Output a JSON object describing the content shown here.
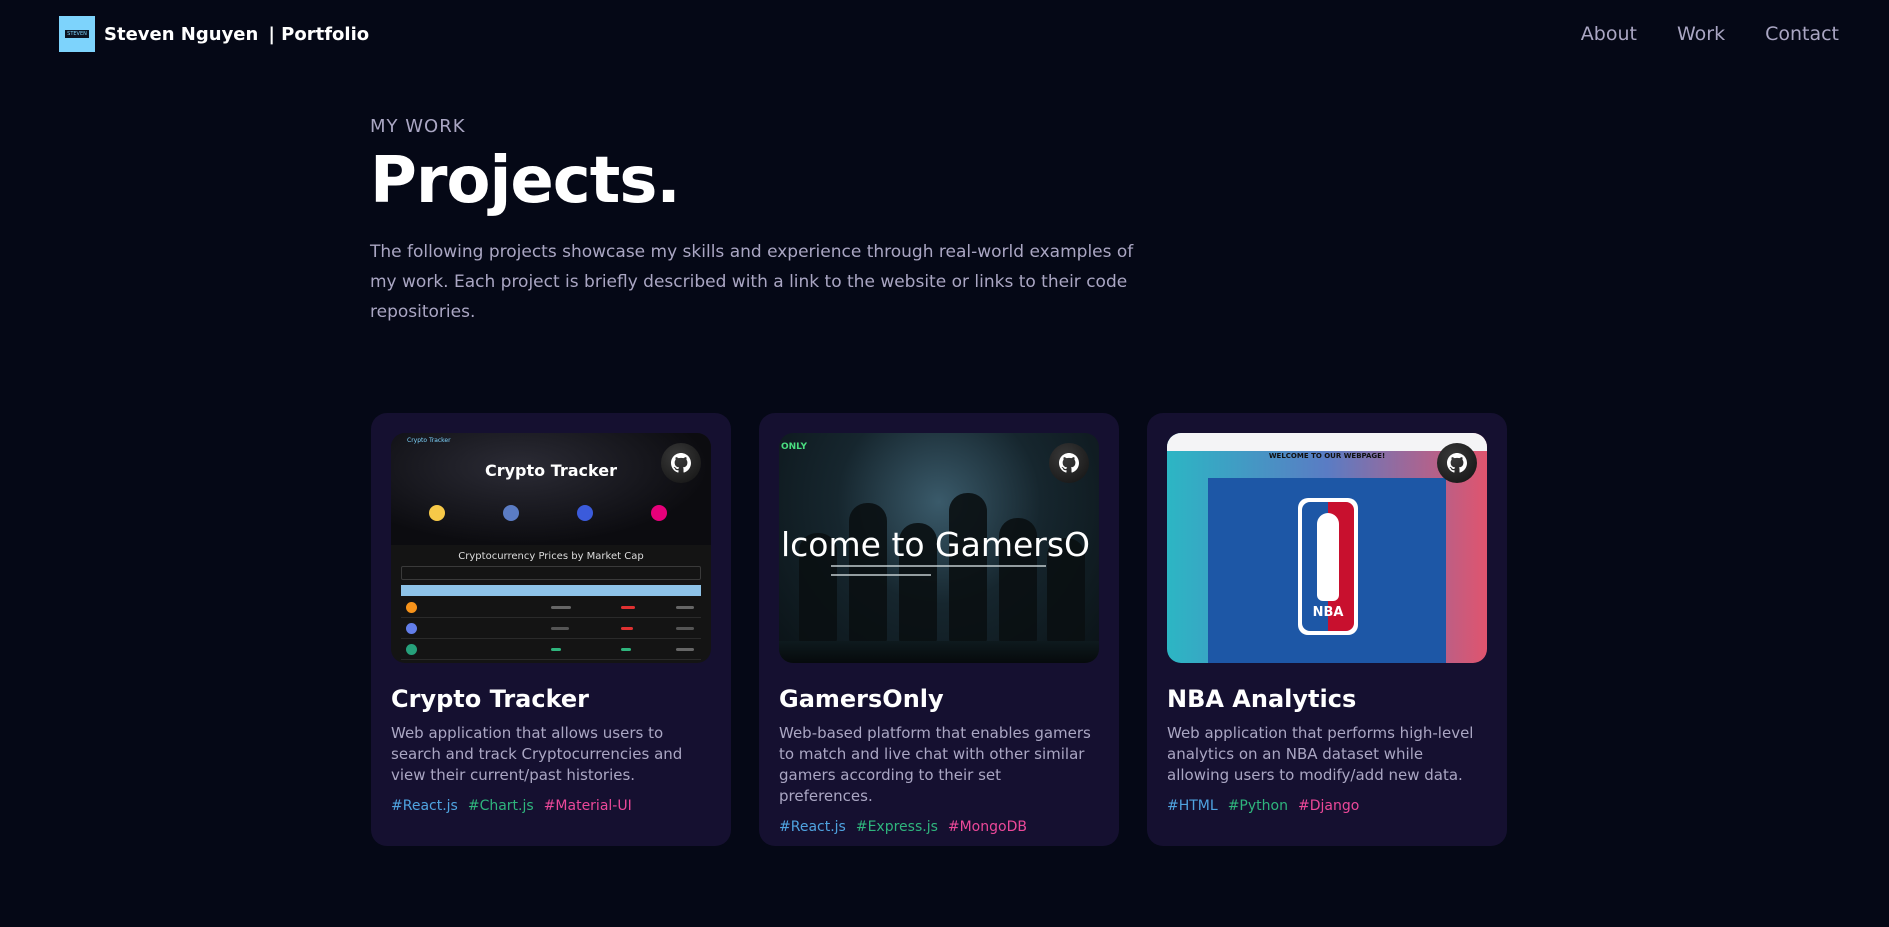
{
  "colors": {
    "background": "#050816",
    "card": "#151030",
    "secondary_text": "#aaa6c3",
    "logo_bg": "#7dd3fc",
    "tag_blue": "#4fa3e0",
    "tag_green": "#2fb57d",
    "tag_pink": "#ec4899"
  },
  "nav": {
    "brand_name": "Steven Nguyen",
    "brand_suffix": "| Portfolio",
    "logo_text": "STEVEN",
    "links": [
      "About",
      "Work",
      "Contact"
    ]
  },
  "section": {
    "subtitle": "MY WORK",
    "title": "Projects.",
    "description": "The following projects showcase my skills and experience through real-world examples of my work. Each project is briefly described with a link to the website or links to their code repositories."
  },
  "projects": [
    {
      "name": "Crypto Tracker",
      "description": "Web application that allows users to search and track Cryptocurrencies and view their current/past histories.",
      "tags": [
        "#React.js",
        "#Chart.js",
        "#Material-UI"
      ],
      "github_icon": "github-icon",
      "preview": {
        "app_label": "Crypto Tracker",
        "hero_title": "Crypto Tracker",
        "table_title": "Cryptocurrency Prices by Market Cap"
      }
    },
    {
      "name": "GamersOnly",
      "description": "Web-based platform that enables gamers to match and live chat with other similar gamers according to their set preferences.",
      "tags": [
        "#React.js",
        "#Express.js",
        "#MongoDB"
      ],
      "github_icon": "github-icon",
      "preview": {
        "logo_text": "ONLY",
        "welcome_text": "lcome to GamersO"
      }
    },
    {
      "name": "NBA Analytics",
      "description": "Web application that performs high-level analytics on an NBA dataset while allowing users to modify/add new data.",
      "tags": [
        "#HTML",
        "#Python",
        "#Django"
      ],
      "github_icon": "github-icon",
      "preview": {
        "welcome_text": "WELCOME TO OUR WEBPAGE!",
        "logo_text": "NBA"
      }
    }
  ]
}
